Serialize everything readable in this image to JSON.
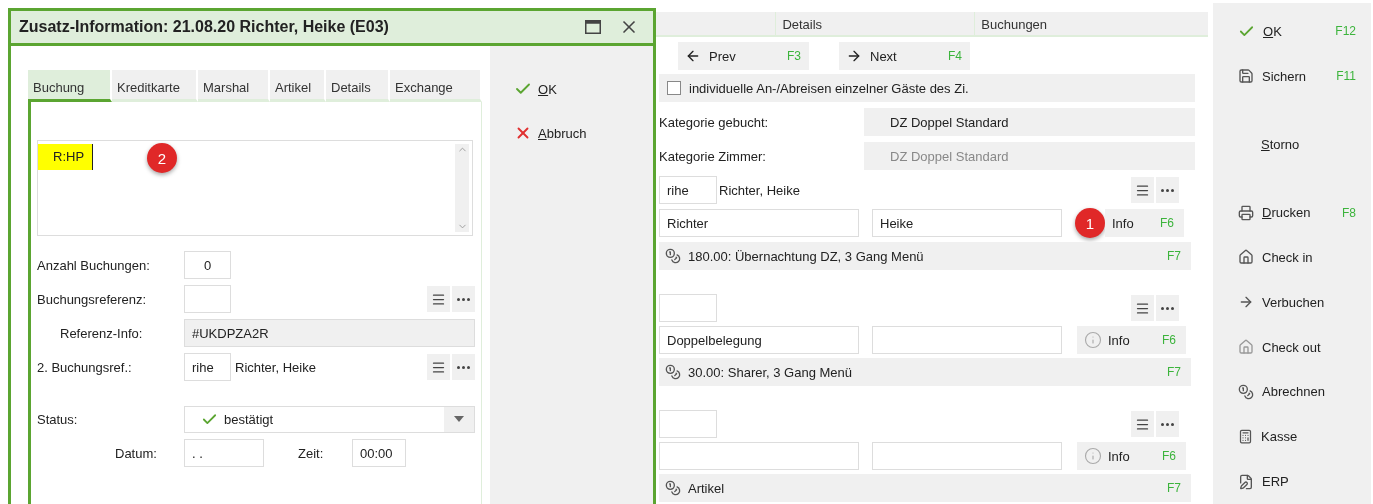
{
  "dialog": {
    "title": "Zusatz-Information: 21.08.20 Richter, Heike (E03)",
    "tabs": [
      {
        "label": "Buchung",
        "selected": true
      },
      {
        "label": "Kreditkarte",
        "selected": false
      },
      {
        "label": "Marshal",
        "selected": false
      },
      {
        "label": "Artikel",
        "selected": false
      },
      {
        "label": "Details",
        "selected": false
      },
      {
        "label": "Exchange",
        "selected": false
      }
    ],
    "notes": {
      "value": "R:HP",
      "highlighted": true,
      "annotation": "2"
    },
    "count": {
      "label": "Anzahl Buchungen:",
      "value": "0"
    },
    "reference": {
      "label": "Buchungsreferenz:"
    },
    "reference_info": {
      "label": "Referenz-Info:",
      "value": "#UKDPZA2R"
    },
    "second_reference": {
      "label": "2. Buchungsref.:",
      "code": "rihe",
      "name": "Richter, Heike"
    },
    "status": {
      "label": "Status:",
      "value": "bestätigt"
    },
    "date": {
      "label": "Datum:",
      "value": ". ."
    },
    "time": {
      "label": "Zeit:",
      "value": "00:00"
    },
    "buttons": [
      {
        "label": "OK",
        "kind": "ok",
        "mnemonic": true
      },
      {
        "label": "Abbruch",
        "kind": "cancel",
        "mnemonic": true
      }
    ]
  },
  "main": {
    "tabs": [
      {
        "label": "Details"
      },
      {
        "label": "Buchungen"
      }
    ],
    "nav": [
      {
        "label": "Prev",
        "key": "F3",
        "kind": "prev"
      },
      {
        "label": "Next",
        "key": "F4",
        "kind": "next"
      }
    ],
    "individual": {
      "label": "individuelle An-/Abreisen einzelner Gäste des Zi.",
      "checked": false
    },
    "categories": [
      {
        "label": "Kategorie gebucht:",
        "value": "DZ Doppel Standard",
        "disabled": false
      },
      {
        "label": "Kategorie Zimmer:",
        "value": "DZ Doppel Standard",
        "disabled": true
      }
    ],
    "guests": [
      {
        "code": "rihe",
        "name": "Richter, Heike",
        "last_name": "Richter",
        "first_name": "Heike",
        "info": "Info",
        "info_key": "F6",
        "annotation": "1",
        "charge": "180.00: Übernachtung DZ, 3 Gang Menü",
        "charge_key": "F7"
      },
      {
        "last_name": "Doppelbelegung",
        "info": "Info",
        "info_key": "F6",
        "charge": "30.00: Sharer, 3 Gang Menü",
        "charge_key": "F7"
      },
      {
        "info": "Info",
        "info_key": "F6",
        "charge": "Artikel",
        "charge_key": "F7"
      }
    ]
  },
  "sidebar": [
    {
      "label": "OK",
      "key": "F12",
      "kind": "check",
      "mnemonic": true
    },
    {
      "label": "Sichern",
      "key": "F11",
      "kind": "save",
      "mnemonic": false
    },
    {
      "label": "Storno",
      "kind": "plain",
      "mnemonic": true
    },
    {
      "label": "Drucken",
      "key": "F8",
      "kind": "print",
      "mnemonic": true
    },
    {
      "label": "Check in",
      "kind": "checkin",
      "mnemonic": false
    },
    {
      "label": "Verbuchen",
      "kind": "arrow",
      "mnemonic": false
    },
    {
      "label": "Check out",
      "kind": "checkout",
      "mnemonic": false
    },
    {
      "label": "Abrechnen",
      "kind": "coins",
      "mnemonic": false
    },
    {
      "label": "Kasse",
      "kind": "register",
      "mnemonic": false
    },
    {
      "label": "ERP",
      "kind": "document",
      "mnemonic": false
    }
  ]
}
